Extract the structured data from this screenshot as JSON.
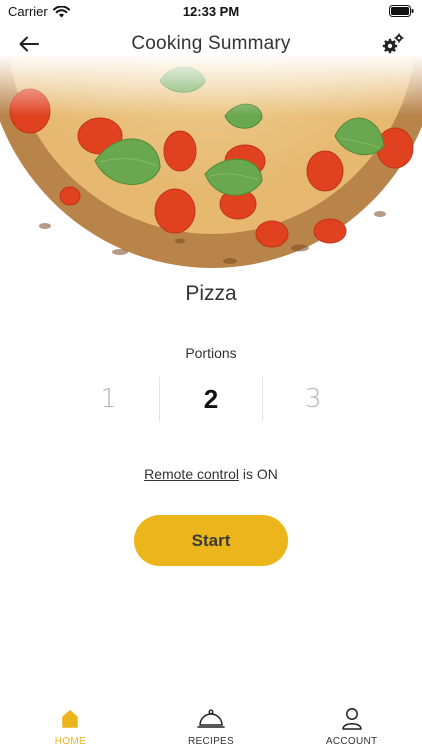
{
  "status_bar": {
    "carrier": "Carrier",
    "time": "12:33 PM"
  },
  "header": {
    "title": "Cooking Summary",
    "back_icon": "arrow-left-icon",
    "settings_icon": "gears-icon"
  },
  "hero": {
    "image": "pizza-photo"
  },
  "recipe": {
    "name": "Pizza"
  },
  "portions": {
    "label": "Portions",
    "options": [
      "1",
      "2",
      "3"
    ],
    "selected": "2"
  },
  "remote": {
    "link_text": "Remote control",
    "status_text": " is ON"
  },
  "actions": {
    "start_label": "Start"
  },
  "colors": {
    "accent": "#edb51c",
    "text": "#333333",
    "muted": "#b3b3b3"
  },
  "tab_bar": {
    "tabs": [
      {
        "label": "HOME",
        "icon": "home-icon",
        "active": true
      },
      {
        "label": "RECIPES",
        "icon": "cloche-icon",
        "active": false
      },
      {
        "label": "ACCOUNT",
        "icon": "user-icon",
        "active": false
      }
    ]
  }
}
